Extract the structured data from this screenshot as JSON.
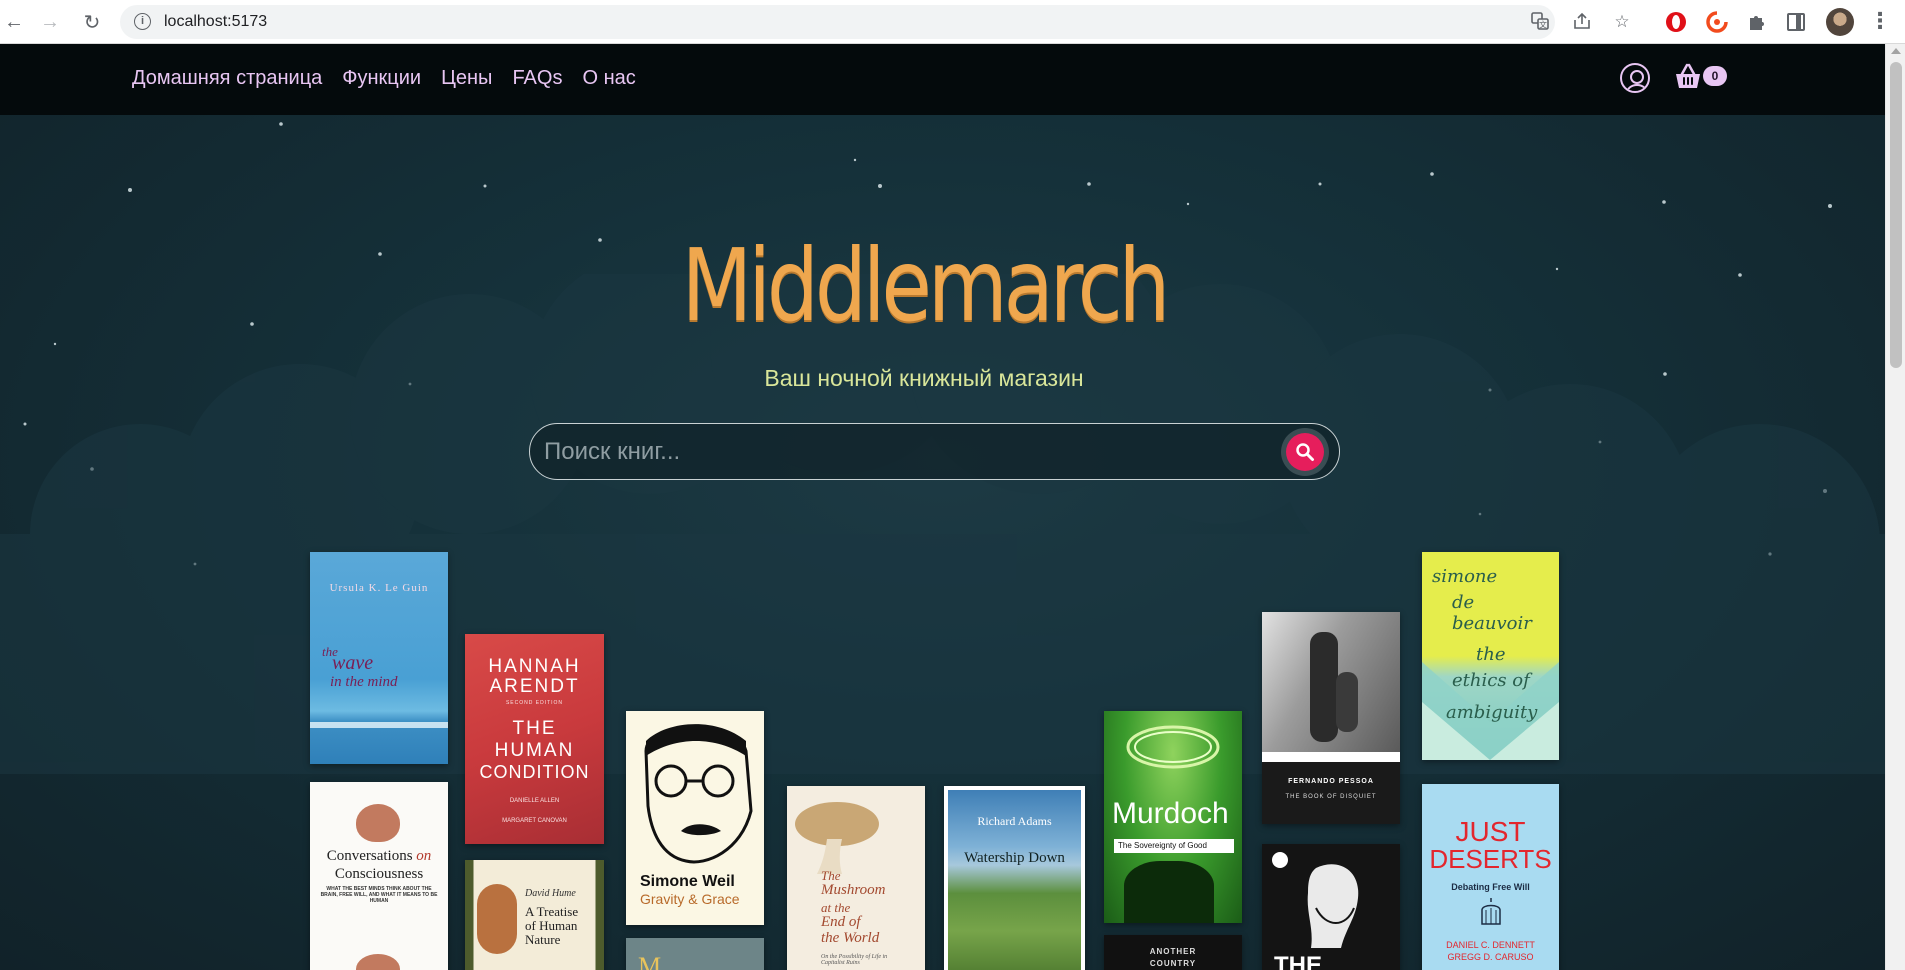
{
  "browser": {
    "url": "localhost:5173",
    "icons": {
      "back": "arrow-left-icon",
      "forward": "arrow-right-icon",
      "reload": "reload-icon",
      "site_info": "info-icon",
      "translate": "translate-icon",
      "share": "share-icon",
      "bookmark": "star-icon",
      "extensions": "puzzle-icon",
      "side_panel": "side-panel-icon",
      "menu": "kebab-menu-icon"
    }
  },
  "nav": {
    "links": [
      "Домашняя страница",
      "Функции",
      "Цены",
      "FAQs",
      "О нас"
    ],
    "cart_count": "0",
    "accent": "#e8c6f3"
  },
  "hero": {
    "title": "Middlemarch",
    "subtitle": "Ваш ночной книжный магазин",
    "search_placeholder": "Поиск книг...",
    "title_color": "#efa74e",
    "subtitle_color": "#d9e69a",
    "search_button_color": "#e61e5c"
  },
  "books": {
    "wave": {
      "author": "Ursula K. Le Guin",
      "title_l1": "the",
      "title_l2": "wave",
      "title_l3": "in the mind"
    },
    "arendt": {
      "author_l1": "HANNAH",
      "author_l2": "ARENDT",
      "title_l1": "THE",
      "title_l2": "HUMAN",
      "title_l3": "CONDITION",
      "line1": "SECOND EDITION",
      "line2": "DANIELLE ALLEN",
      "line3": "MARGARET CANOVAN"
    },
    "weil": {
      "author": "Simone Weil",
      "title": "Gravity & Grace"
    },
    "mushroom": {
      "title_l1": "The",
      "title_l2": "Mushroom",
      "title_l3": "at the",
      "title_l4": "End of",
      "title_l5": "the World",
      "sub": "On the Possibility of Life in Capitalist Ruins"
    },
    "watership": {
      "author": "Richard Adams",
      "title": "Watership Down"
    },
    "murdoch": {
      "author": "Murdoch",
      "title": "The Sovereignty of Good"
    },
    "pessoa": {
      "author": "FERNANDO PESSOA",
      "title": "THE BOOK OF DISQUIET"
    },
    "beauvoir": {
      "l1": "simone",
      "l2": "de beauvoir",
      "l3": "the",
      "l4": "ethics of",
      "l5": "ambiguity"
    },
    "conversations": {
      "title_l1": "Conversations",
      "title_l2": "on",
      "title_l3": "Consciousness",
      "sub": "WHAT THE BEST MINDS THINK ABOUT THE BRAIN, FREE WILL, AND WHAT IT MEANS TO BE HUMAN"
    },
    "hume": {
      "author": "David Hume",
      "title_l1": "A Treatise",
      "title_l2": "of Human",
      "title_l3": "Nature"
    },
    "another_country": {
      "l1": "ANOTHER",
      "l2": "COUNTRY"
    },
    "the_book": {
      "title": "THE"
    },
    "deserts": {
      "l1": "JUST",
      "l2": "DESERTS",
      "sub": "Debating Free Will",
      "a1": "DANIEL C. DENNETT",
      "a2": "GREGG D. CARUSO"
    }
  }
}
